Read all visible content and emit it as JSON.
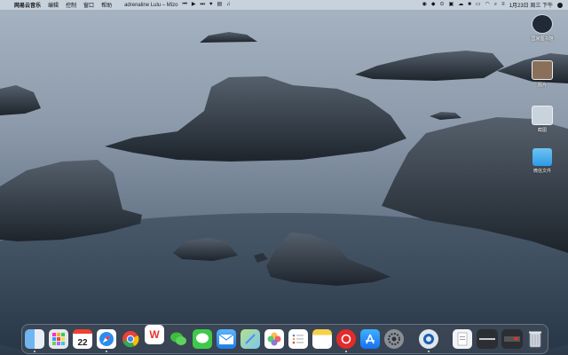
{
  "menubar": {
    "app_name": "网易云音乐",
    "menus": [
      "编辑",
      "控制",
      "窗口",
      "帮助"
    ],
    "now_playing": "adrenaline Lulu – Mizo",
    "datetime": "1月23日 周三 下午"
  },
  "desktop_icons": [
    {
      "label": "国家图书馆",
      "icon": "profile-icon"
    },
    {
      "label": "图片",
      "icon": "photo-icon"
    },
    {
      "label": "截图",
      "icon": "screenshot-icon"
    },
    {
      "label": "微信文件",
      "icon": "folder-icon"
    }
  ],
  "dock": {
    "calendar_day": "22",
    "apps": [
      "Finder",
      "Launchpad",
      "Calendar",
      "Safari",
      "Chrome",
      "WPS",
      "WeChat",
      "Messages",
      "Mail",
      "Maps",
      "Photos",
      "Reminders",
      "Notes",
      "NetEase Music",
      "App Store",
      "System Preferences",
      "QuickTime",
      "Document",
      "Screen Capture",
      "Terminal",
      "Trash"
    ]
  }
}
